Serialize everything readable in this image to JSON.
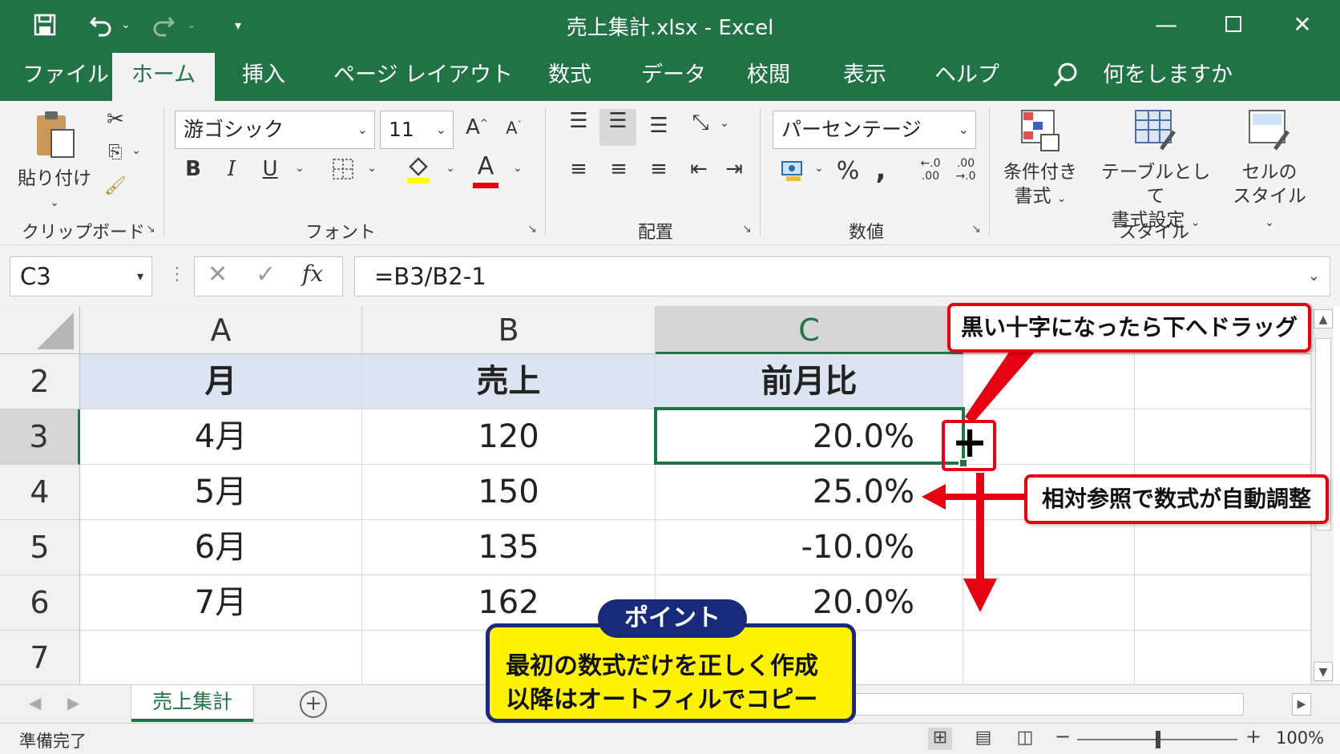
{
  "window": {
    "title": "売上集計.xlsx  -  Excel"
  },
  "quick_access": {
    "save_icon": "save-icon",
    "undo_icon": "undo-icon",
    "redo_icon": "redo-icon",
    "customize_icon": "customize-icon"
  },
  "tabs": [
    {
      "label": "ファイル"
    },
    {
      "label": "ホーム"
    },
    {
      "label": "挿入"
    },
    {
      "label": "ページ レイアウト"
    },
    {
      "label": "数式"
    },
    {
      "label": "データ"
    },
    {
      "label": "校閲"
    },
    {
      "label": "表示"
    },
    {
      "label": "ヘルプ"
    }
  ],
  "tell_me": {
    "placeholder": "何をしますか"
  },
  "ribbon": {
    "clipboard": {
      "paste_label": "貼り付け",
      "group_label": "クリップボード"
    },
    "font": {
      "name": "游ゴシック",
      "size": "11",
      "bold": "B",
      "italic": "I",
      "underline": "U",
      "grow": "A",
      "shrink": "A",
      "font_color": "A",
      "group_label": "フォント"
    },
    "alignment": {
      "group_label": "配置"
    },
    "number": {
      "format": "パーセンテージ",
      "percent": "%",
      "comma": ",",
      "inc_decimal": "←.0\n.00",
      "dec_decimal": ".00\n→.0",
      "group_label": "数値"
    },
    "styles": {
      "conditional_line1": "条件付き",
      "conditional_line2": "書式",
      "table_line1": "テーブルとして",
      "table_line2": "書式設定",
      "cell_line1": "セルの",
      "cell_line2": "スタイル",
      "group_label": "スタイル"
    }
  },
  "formula_bar": {
    "name_box": "C3",
    "cancel": "✕",
    "enter": "✓",
    "fx": "fx",
    "formula": "=B3/B2-1"
  },
  "columns": [
    "A",
    "B",
    "C"
  ],
  "rows": [
    {
      "num": "2",
      "a": "月",
      "b": "売上",
      "c": "前月比"
    },
    {
      "num": "3",
      "a": "4月",
      "b": "120",
      "c": "20.0%"
    },
    {
      "num": "4",
      "a": "5月",
      "b": "150",
      "c": "25.0%"
    },
    {
      "num": "5",
      "a": "6月",
      "b": "135",
      "c": "-10.0%"
    },
    {
      "num": "6",
      "a": "7月",
      "b": "162",
      "c": "20.0%"
    },
    {
      "num": "7",
      "a": "",
      "b": "",
      "c": ""
    }
  ],
  "sheet_tabs": [
    {
      "label": "売上集計"
    }
  ],
  "status": {
    "text": "準備完了",
    "zoom": "100%"
  },
  "annotations": {
    "drag_callout": "黒い十字になったら下へドラッグ",
    "relative_callout": "相対参照で数式が自動調整",
    "cursor_glyph": "+",
    "point_badge": "ポイント",
    "point_line1": "最初の数式だけを正しく作成",
    "point_line2": "以降はオートフィルでコピー"
  },
  "colors": {
    "excel_green": "#217346",
    "header_fill": "#dbe5f2",
    "callout_red": "#e60012",
    "point_yellow": "#fff200",
    "point_navy": "#1a2a7a"
  }
}
